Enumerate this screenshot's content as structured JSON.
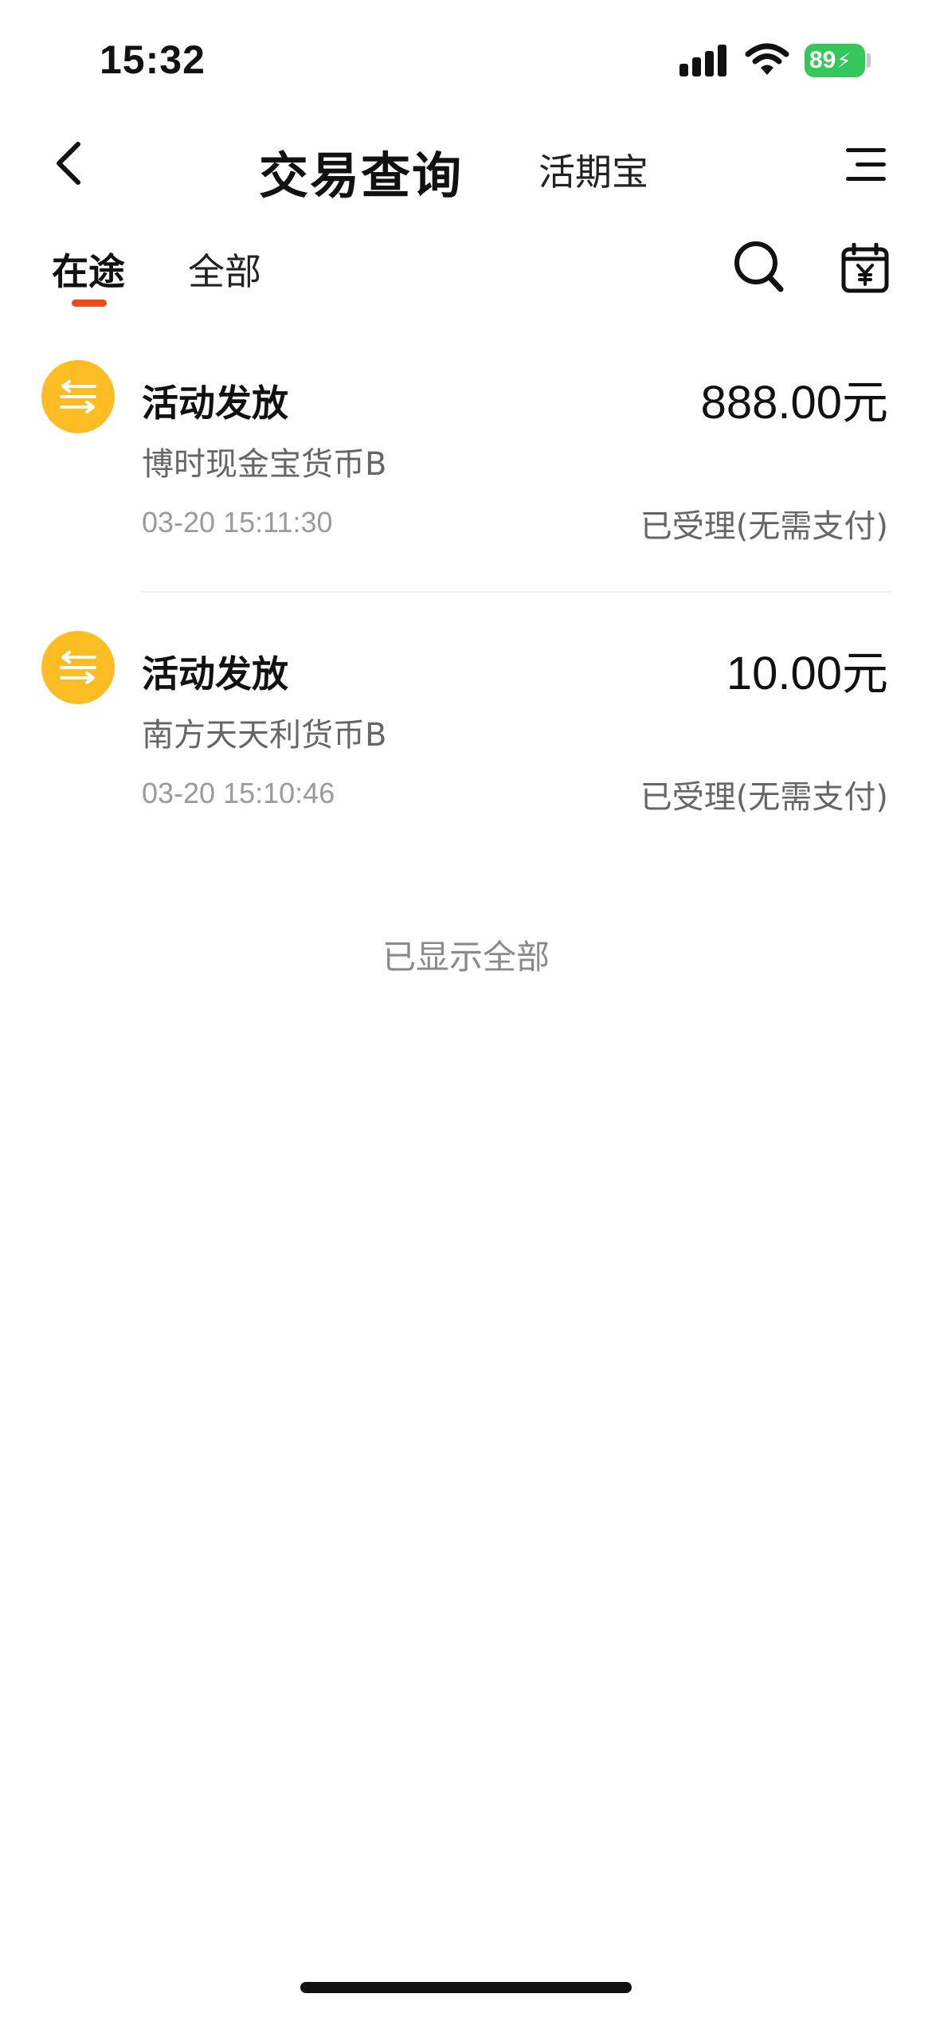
{
  "status_bar": {
    "time": "15:32",
    "battery": "89"
  },
  "nav": {
    "title": "交易查询",
    "subtitle": "活期宝"
  },
  "tabs": [
    {
      "label": "在途",
      "active": true
    },
    {
      "label": "全部",
      "active": false
    }
  ],
  "transactions": [
    {
      "title": "活动发放",
      "amount": "888.00元",
      "fund": "博时现金宝货币B",
      "time": "03-20 15:11:30",
      "status": "已受理(无需支付)"
    },
    {
      "title": "活动发放",
      "amount": "10.00元",
      "fund": "南方天天利货币B",
      "time": "03-20 15:10:46",
      "status": "已受理(无需支付)"
    }
  ],
  "footer": {
    "note": "已显示全部"
  },
  "colors": {
    "accent": "#f0491a",
    "avatar": "#fbbd23",
    "battery": "#35c759"
  },
  "icons": [
    "back-arrow-icon",
    "menu-icon",
    "search-icon",
    "calendar-yen-icon",
    "transfer-icon"
  ]
}
